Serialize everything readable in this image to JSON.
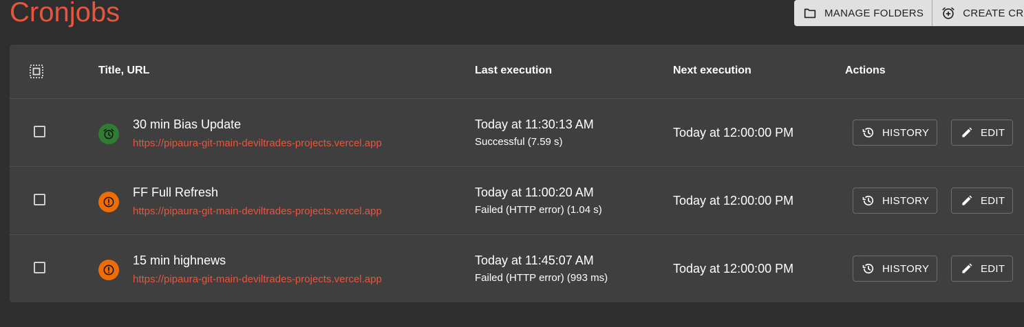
{
  "page": {
    "title": "Cronjobs"
  },
  "toolbar": {
    "manage_folders_label": "MANAGE FOLDERS",
    "create_cronjob_label": "CREATE CRONJOB",
    "manage_folders_icon": "folder-icon",
    "create_cronjob_icon": "alarm-add-icon"
  },
  "table": {
    "columns": {
      "title_url": "Title, URL",
      "last_execution": "Last execution",
      "next_execution": "Next execution",
      "actions": "Actions"
    },
    "rows": [
      {
        "status": "success",
        "status_icon": "alarm-icon",
        "title": "30 min Bias Update",
        "url": "https://pipaura-git-main-deviltrades-projects.vercel.app",
        "last_time": "Today at 11:30:13 AM",
        "last_status": "Successful (7.59 s)",
        "next_time": "Today at 12:00:00 PM",
        "history_label": "HISTORY",
        "edit_label": "EDIT"
      },
      {
        "status": "failed",
        "status_icon": "alert-icon",
        "title": "FF Full Refresh",
        "url": "https://pipaura-git-main-deviltrades-projects.vercel.app",
        "last_time": "Today at 11:00:20 AM",
        "last_status": "Failed (HTTP error) (1.04 s)",
        "next_time": "Today at 12:00:00 PM",
        "history_label": "HISTORY",
        "edit_label": "EDIT"
      },
      {
        "status": "failed",
        "status_icon": "alert-icon",
        "title": "15 min highnews",
        "url": "https://pipaura-git-main-deviltrades-projects.vercel.app",
        "last_time": "Today at 11:45:07 AM",
        "last_status": "Failed (HTTP error) (993 ms)",
        "next_time": "Today at 12:00:00 PM",
        "history_label": "HISTORY",
        "edit_label": "EDIT"
      }
    ]
  },
  "colors": {
    "accent": "#e8553d",
    "background": "#2e2e2e",
    "card": "#3f3f3f",
    "success": "#2e7d32",
    "failure": "#ef6c00"
  }
}
